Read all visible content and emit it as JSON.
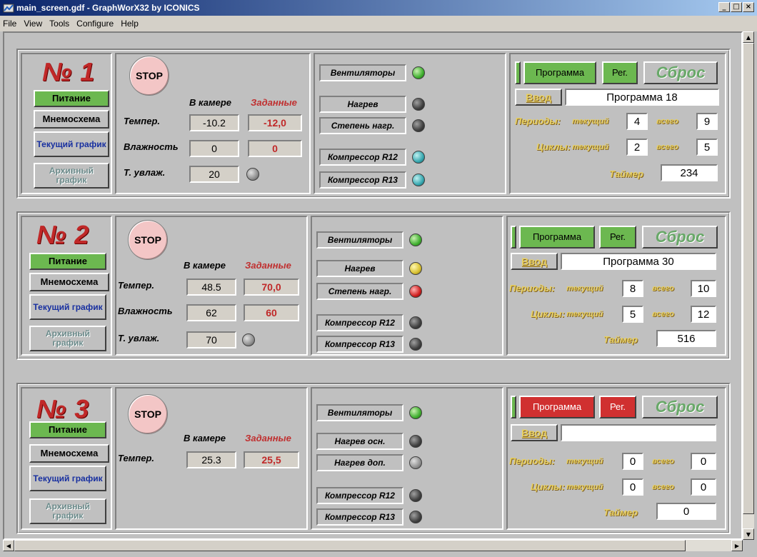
{
  "window": {
    "title": "main_screen.gdf - GraphWorX32 by ICONICS"
  },
  "menu": [
    "File",
    "View",
    "Tools",
    "Configure",
    "Help"
  ],
  "common": {
    "power": "Питание",
    "mnemo": "Мнемосхема",
    "current_chart": "Текущий график",
    "archive_chart": "Архивный график",
    "stop": "STOP",
    "in_chamber": "В камере",
    "setpoints": "Заданные",
    "temp": "Темпер.",
    "humidity": "Влажность",
    "t_humid": "Т. увлаж.",
    "program": "Программа",
    "reg": "Рег.",
    "reset": "Сброс",
    "enter": "Ввод",
    "periods": "Периоды:",
    "cycles": "Циклы:",
    "current": "текущий",
    "total": "всего",
    "timer": "Таймер",
    "fans": "Вентиляторы",
    "heating": "Нагрев",
    "heat_degree": "Степень нагр.",
    "heat_main": "Нагрев осн.",
    "heat_extra": "Нагрев доп.",
    "comp_r12": "Компрессор R12",
    "comp_r13": "Компрессор R13"
  },
  "chambers": [
    {
      "number": "№ 1",
      "temp_actual": "-10.2",
      "temp_set": "-12,0",
      "hum_actual": "0",
      "hum_set": "0",
      "t_humid": "20",
      "program_name": "Программа 18",
      "period_current": "4",
      "period_total": "9",
      "cycle_current": "2",
      "cycle_total": "5",
      "timer": "234",
      "status_colors": {
        "fans": "green",
        "heating": "dark",
        "degree": "dark",
        "r12": "cyan",
        "r13": "cyan",
        "humid": "grey",
        "program": "green"
      }
    },
    {
      "number": "№ 2",
      "temp_actual": "48.5",
      "temp_set": "70,0",
      "hum_actual": "62",
      "hum_set": "60",
      "t_humid": "70",
      "program_name": "Программа 30",
      "period_current": "8",
      "period_total": "10",
      "cycle_current": "5",
      "cycle_total": "12",
      "timer": "516",
      "status_colors": {
        "fans": "green",
        "heating": "yellow",
        "degree": "red",
        "r12": "dark",
        "r13": "dark",
        "humid": "grey",
        "program": "green"
      }
    },
    {
      "number": "№ 3",
      "temp_actual": "25.3",
      "temp_set": "25,5",
      "program_name": "",
      "period_current": "0",
      "period_total": "0",
      "cycle_current": "0",
      "cycle_total": "0",
      "timer": "0",
      "status_colors": {
        "fans": "green",
        "heat_main": "dark",
        "heat_extra": "grey",
        "r12": "dark",
        "r13": "dark",
        "program": "red"
      }
    }
  ]
}
